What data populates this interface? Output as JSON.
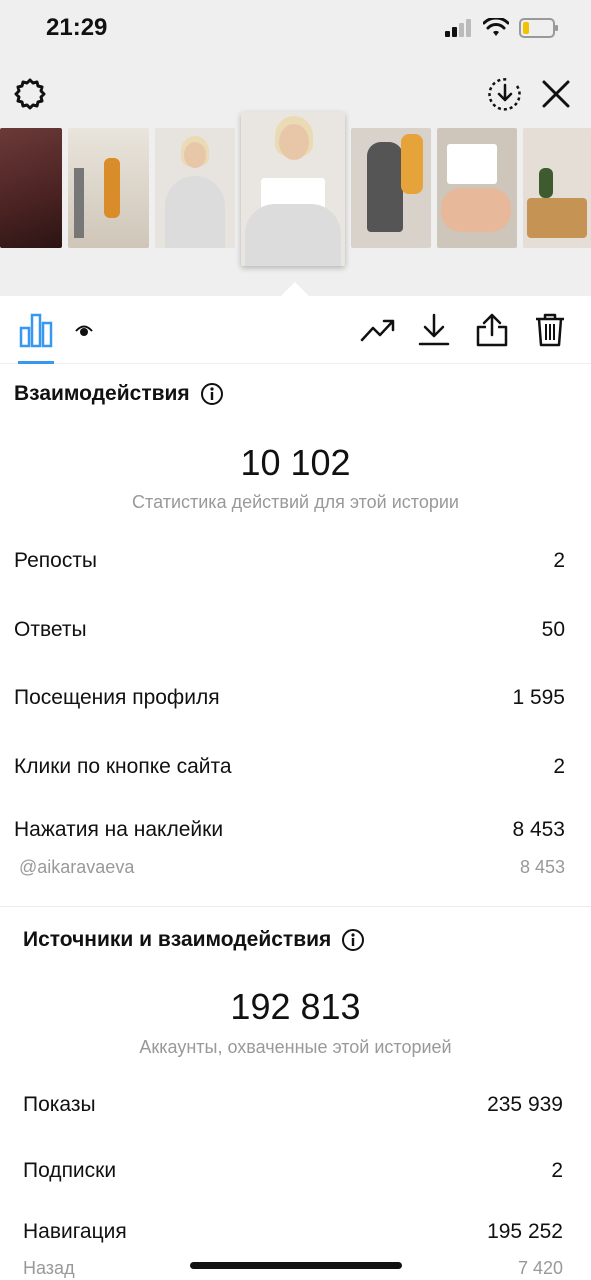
{
  "status_bar": {
    "time": "21:29"
  },
  "interactions": {
    "title": "Взаимодействия",
    "total": "10 102",
    "caption": "Статистика действий для этой истории",
    "rows": [
      {
        "label": "Репосты",
        "value": "2"
      },
      {
        "label": "Ответы",
        "value": "50"
      },
      {
        "label": "Посещения профиля",
        "value": "1 595"
      },
      {
        "label": "Клики по кнопке сайта",
        "value": "2"
      },
      {
        "label": "Нажатия на наклейки",
        "value": "8 453"
      }
    ],
    "sticker": {
      "label": "@aikaravaeva",
      "value": "8 453"
    }
  },
  "discovery": {
    "title": "Источники и взаимодействия",
    "total": "192 813",
    "caption": "Аккаунты, охваченные этой историей",
    "rows": [
      {
        "label": "Показы",
        "value": "235 939"
      },
      {
        "label": "Подписки",
        "value": "2"
      },
      {
        "label": "Навигация",
        "value": "195 252"
      }
    ],
    "sub": {
      "label": "Назад",
      "value": "7 420"
    }
  },
  "colors": {
    "accent": "#3897f0",
    "background_top": "#efefef"
  },
  "icons": [
    "settings-icon",
    "download-circle-icon",
    "close-icon",
    "insights-bar-icon",
    "eye-icon",
    "trend-icon",
    "download-icon",
    "share-icon",
    "trash-icon",
    "info-icon"
  ]
}
